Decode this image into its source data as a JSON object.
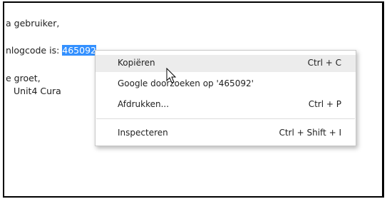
{
  "email": {
    "greeting": "a gebruiker,",
    "code_prefix": "nlogcode is: ",
    "code_value": "465092",
    "closing": "e groet,",
    "signature": "Unit4 Cura"
  },
  "context_menu": {
    "items": [
      {
        "label": "Kopiëren",
        "shortcut": "Ctrl + C"
      },
      {
        "label": "Google doorzoeken op '465092'",
        "shortcut": ""
      },
      {
        "label": "Afdrukken...",
        "shortcut": "Ctrl + P"
      },
      {
        "label": "Inspecteren",
        "shortcut": "Ctrl + Shift + I"
      }
    ]
  },
  "colors": {
    "selection": "#3390ff",
    "menu_hover": "#ececec"
  }
}
